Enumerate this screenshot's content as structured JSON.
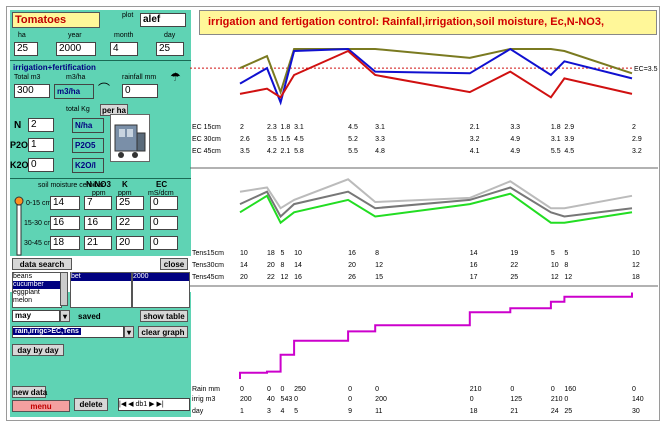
{
  "header": {
    "crop": "Tomatoes",
    "plot_label": "plot",
    "plot": "alef"
  },
  "date": {
    "ha_label": "ha",
    "year_label": "year",
    "month_label": "month",
    "day_label": "day",
    "ha": "25",
    "year": "2000",
    "month": "4",
    "day": "25"
  },
  "irrigation": {
    "section_label": "irrigation+fertification",
    "total_label": "Total  m3",
    "rate_label": "m3/ha",
    "rainfall_label": "rainfall mm",
    "total": "300",
    "unit": "m3/ha",
    "rainfall": "0"
  },
  "fert": {
    "total_kg_label": "total Kg",
    "per_ha": "per ha",
    "n_label": "N",
    "n_value": "2",
    "n_unit": "N/ha",
    "p_label": "P2O5",
    "p_value": "1",
    "p_unit": "P2O5",
    "k_label": "K2O",
    "k_value": "0",
    "k_unit": "K2O/l"
  },
  "soil": {
    "moist_label": "soil moisture centibar",
    "no3_label": "N-NO3",
    "no3_unit": "ppm",
    "k_label": "K",
    "k_unit": "ppm",
    "ec_label": "EC",
    "ec_unit": "mS/dcm",
    "rows": [
      {
        "depth": "0-15 cm",
        "moist": "14",
        "no3": "7",
        "k": "25",
        "ec": "0"
      },
      {
        "depth": "15-30 cm",
        "moist": "16",
        "no3": "16",
        "k": "22",
        "ec": "0"
      },
      {
        "depth": "30-45 cm",
        "moist": "18",
        "no3": "21",
        "k": "20",
        "ec": "0"
      }
    ]
  },
  "buttons": {
    "data_search": "data search",
    "close": "close",
    "show_table": "show table",
    "clear_graph": "clear graph",
    "day_by_day": "day by day",
    "new_data": "new data",
    "menu": "menu",
    "delete": "delete"
  },
  "lists": {
    "crops": [
      "beans",
      "cucumber",
      "eggplant",
      "melon"
    ],
    "list2_selected": "bet",
    "list3_item": "2000",
    "month_select": "may",
    "saved": "saved",
    "graph_select": "rain,irrigc>EC,Tens"
  },
  "nav": {
    "first": "|◀",
    "prev": "◀",
    "record": "db1",
    "next": "▶",
    "last": "▶|"
  },
  "title": "irrigation  and  fertigation control: Rainfall,irrigation,soil moisture, Ec,N-NO3,",
  "chart_data": {
    "type": "line",
    "title": "irrigation  and  fertigation control: Rainfall,irrigation,soil moisture, Ec,N-NO3,",
    "days": [
      1,
      3,
      4,
      5,
      9,
      11,
      18,
      21,
      24,
      25,
      30
    ],
    "ec_ref_label": "EC=3.5",
    "ec_ref_value": 3.5,
    "ec_ylim": [
      1.0,
      4.5
    ],
    "ec_series": [
      {
        "name": "EC 15cm",
        "color": "#d01010",
        "labels": [
          "2",
          "2.3",
          "1.8",
          "3.1",
          "4.5",
          "3.1",
          "2.1",
          "3.3",
          "1.8",
          "2.9",
          "2"
        ],
        "values": [
          2,
          2.3,
          1.8,
          3.1,
          4.5,
          3.1,
          2.1,
          3.3,
          1.8,
          2.9,
          2
        ]
      },
      {
        "name": "EC 30cm",
        "color": "#1010d0",
        "labels": [
          "2.6",
          "3.5",
          "1.5",
          "4.5",
          "5.2",
          "3.3",
          "3.2",
          "4.9",
          "3.1",
          "3.9",
          "2.9"
        ],
        "values": [
          2.6,
          3.5,
          1.5,
          4.5,
          5.2,
          3.3,
          3.2,
          4.9,
          3.1,
          3.9,
          2.9
        ]
      },
      {
        "name": "EC 45cm",
        "color": "#7a7a20",
        "labels": [
          "3.5",
          "4.2",
          "2.1",
          "5.8",
          "5.5",
          "4.8",
          "4.1",
          "4.9",
          "5.5",
          "4.5",
          "3.2"
        ],
        "values": [
          3.5,
          4.2,
          2.1,
          5.8,
          5.5,
          4.8,
          4.1,
          4.9,
          5.5,
          4.5,
          3.2
        ]
      }
    ],
    "tens_ylim": [
      0,
      30
    ],
    "tens_series": [
      {
        "name": "Tens15cm",
        "color": "#22dd22",
        "labels": [
          "10",
          "18",
          "5",
          "10",
          "16",
          "8",
          "14",
          "19",
          "5",
          "5",
          "10"
        ],
        "values": [
          10,
          18,
          5,
          10,
          16,
          8,
          14,
          19,
          5,
          5,
          10
        ]
      },
      {
        "name": "Tens30cm",
        "color": "#777777",
        "labels": [
          "14",
          "20",
          "8",
          "14",
          "20",
          "12",
          "16",
          "22",
          "10",
          "8",
          "12"
        ],
        "values": [
          14,
          20,
          8,
          14,
          20,
          12,
          16,
          22,
          10,
          8,
          12
        ]
      },
      {
        "name": "Tens45cm",
        "color": "#bbbbbb",
        "labels": [
          "20",
          "22",
          "12",
          "16",
          "26",
          "15",
          "17",
          "25",
          "12",
          "12",
          "18"
        ],
        "values": [
          20,
          22,
          12,
          16,
          26,
          15,
          17,
          25,
          12,
          12,
          18
        ]
      }
    ],
    "rain": {
      "name": "Rain mm",
      "labels": [
        "0",
        "0",
        "0",
        "250",
        "0",
        "0",
        "210",
        "0",
        "0",
        "160",
        "0"
      ]
    },
    "irrig": {
      "name": "irrig m3",
      "labels": [
        "200",
        "40",
        "543",
        "0",
        "0",
        "200",
        "0",
        "125",
        "210",
        "0",
        "140"
      ]
    },
    "day_label": "day",
    "cumulative": {
      "color": "#cc00cc",
      "values": [
        200,
        240,
        783,
        1233,
        1533,
        1733,
        2153,
        2278,
        2488,
        2648,
        2788
      ],
      "ylim": [
        0,
        2900
      ]
    }
  }
}
